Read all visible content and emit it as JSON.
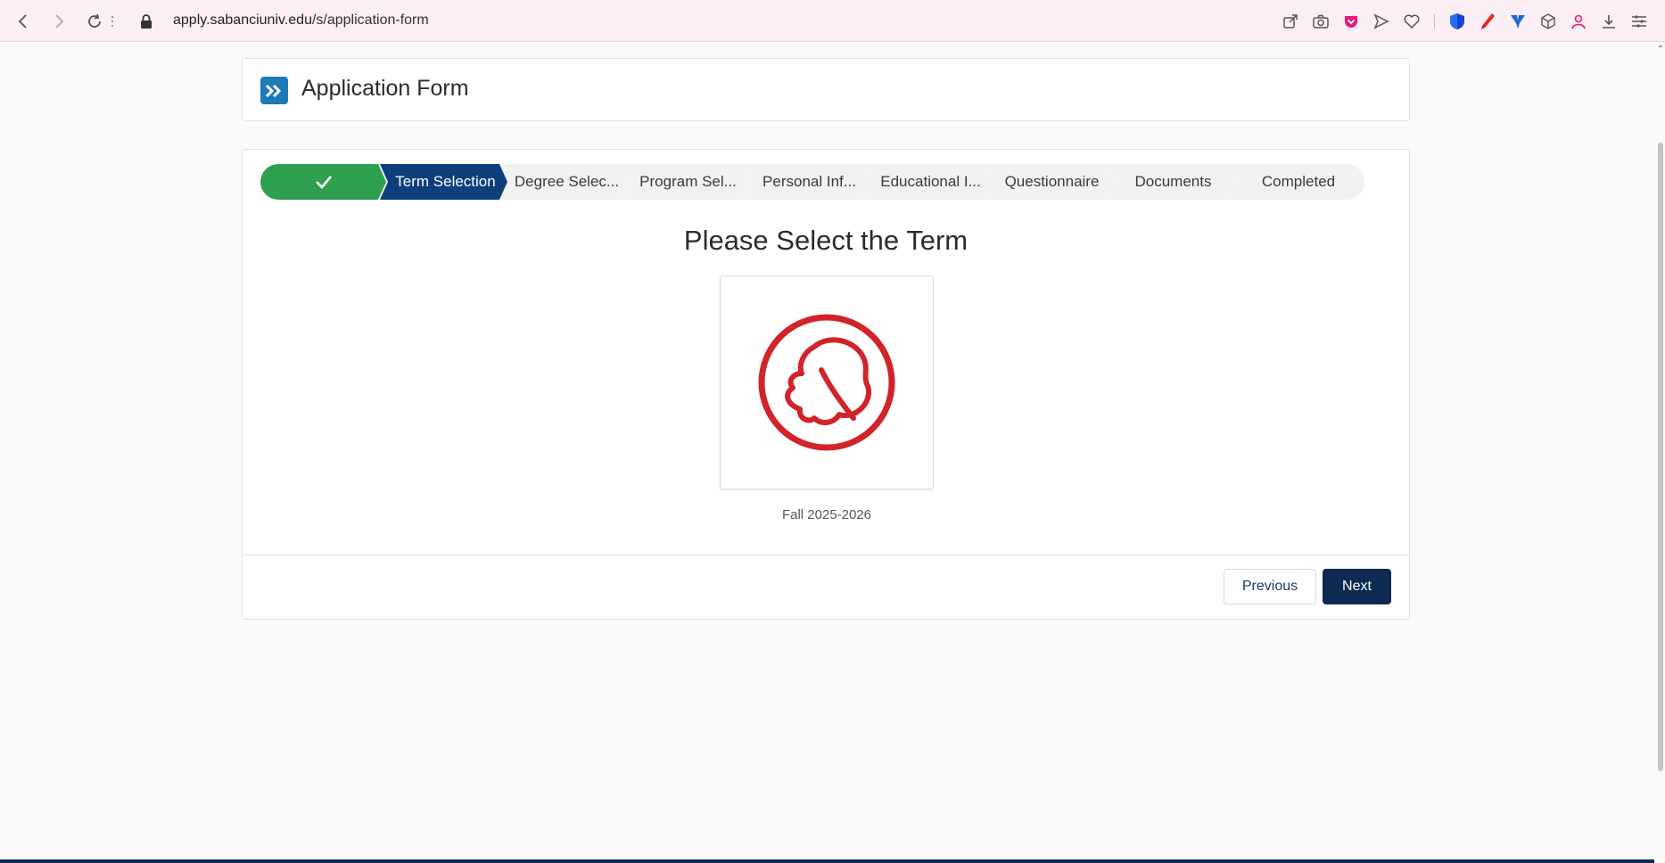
{
  "browser": {
    "url_host": "apply.sabanciuniv.edu",
    "url_path": "/s/application-form",
    "icons": [
      "share-icon",
      "camera-icon",
      "pocket-icon",
      "send-icon",
      "heart-icon",
      "shield-icon",
      "pen-icon",
      "extension-icon",
      "cube-icon",
      "profile-icon",
      "download-icon",
      "menu-icon"
    ]
  },
  "header": {
    "title": "Application Form",
    "logo_color": "#1f7ab8"
  },
  "path": {
    "steps": [
      {
        "label": "",
        "status": "complete"
      },
      {
        "label": "Term Selection",
        "status": "current"
      },
      {
        "label": "Degree Selec...",
        "status": "incomplete"
      },
      {
        "label": "Program Sel...",
        "status": "incomplete"
      },
      {
        "label": "Personal Inf...",
        "status": "incomplete"
      },
      {
        "label": "Educational I...",
        "status": "incomplete"
      },
      {
        "label": "Questionnaire",
        "status": "incomplete"
      },
      {
        "label": "Documents",
        "status": "incomplete"
      },
      {
        "label": "Completed",
        "status": "incomplete"
      }
    ],
    "colors": {
      "complete": "#2e9e4f",
      "current": "#0e3f7a"
    }
  },
  "main": {
    "heading": "Please Select the Term",
    "terms": [
      {
        "label": "Fall 2025-2026",
        "icon": "leaf-icon",
        "icon_color": "#d2232a"
      }
    ]
  },
  "footer": {
    "previous_label": "Previous",
    "next_label": "Next"
  }
}
